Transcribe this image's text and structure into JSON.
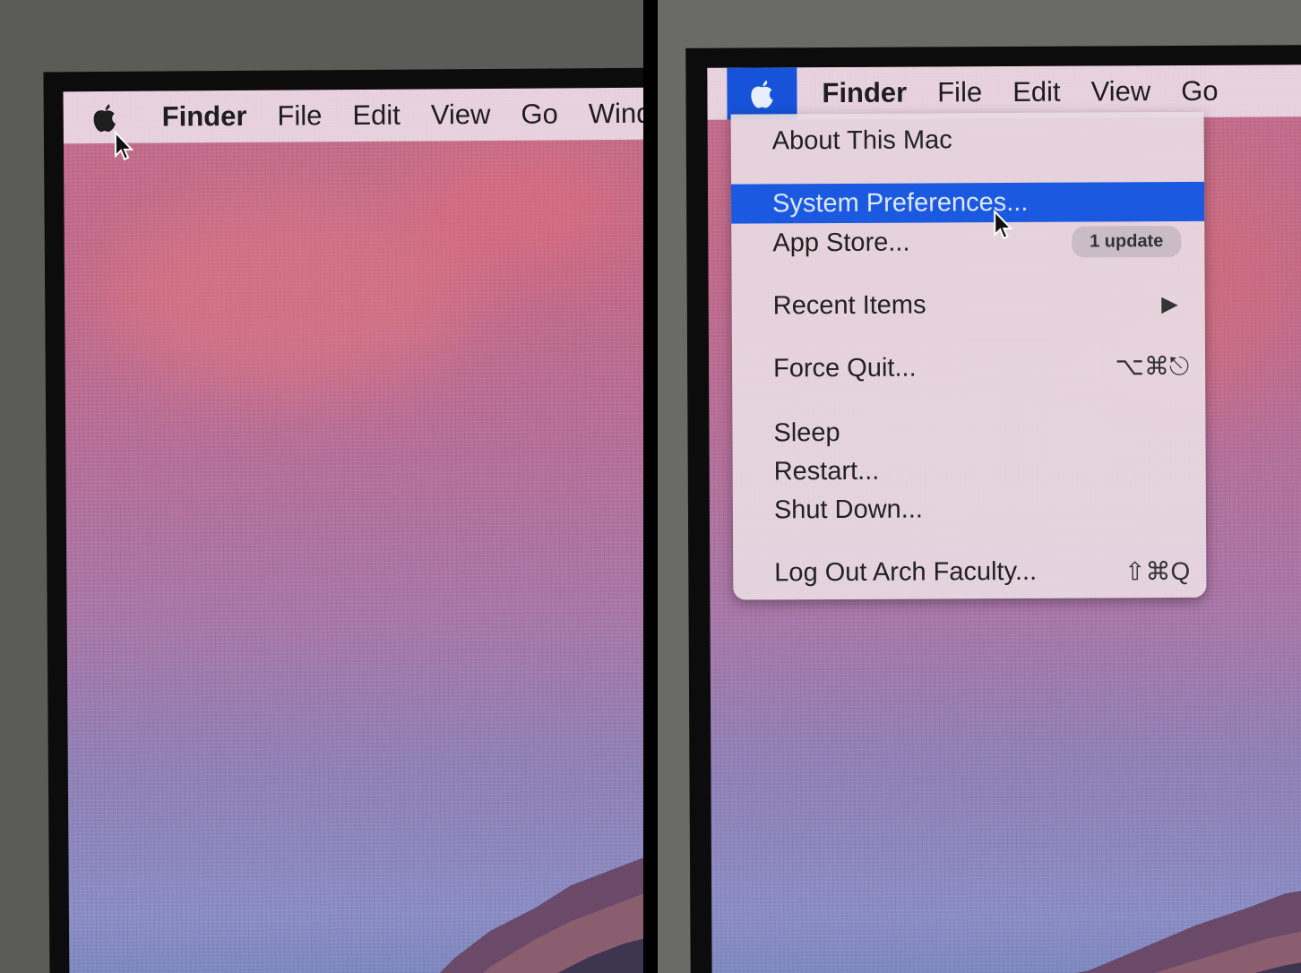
{
  "left_screen": {
    "menubar": {
      "apple_icon": "apple-logo-icon",
      "items": [
        "Finder",
        "File",
        "Edit",
        "View",
        "Go",
        "Winde"
      ]
    }
  },
  "right_screen": {
    "menubar": {
      "apple_icon": "apple-logo-icon",
      "items": [
        "Finder",
        "File",
        "Edit",
        "View",
        "Go"
      ]
    },
    "apple_menu": {
      "about": "About This Mac",
      "system_preferences": "System Preferences...",
      "app_store": "App Store...",
      "app_store_badge": "1 update",
      "recent_items": "Recent Items",
      "recent_items_arrow": "▶",
      "force_quit": "Force Quit...",
      "force_quit_shortcut": "⌥⌘⎋",
      "sleep": "Sleep",
      "restart": "Restart...",
      "shut_down": "Shut Down...",
      "log_out": "Log Out Arch Faculty...",
      "log_out_shortcut": "⇧⌘Q"
    }
  },
  "colors": {
    "menu_highlight": "#1b5ae0",
    "apple_active": "#1653d8"
  }
}
